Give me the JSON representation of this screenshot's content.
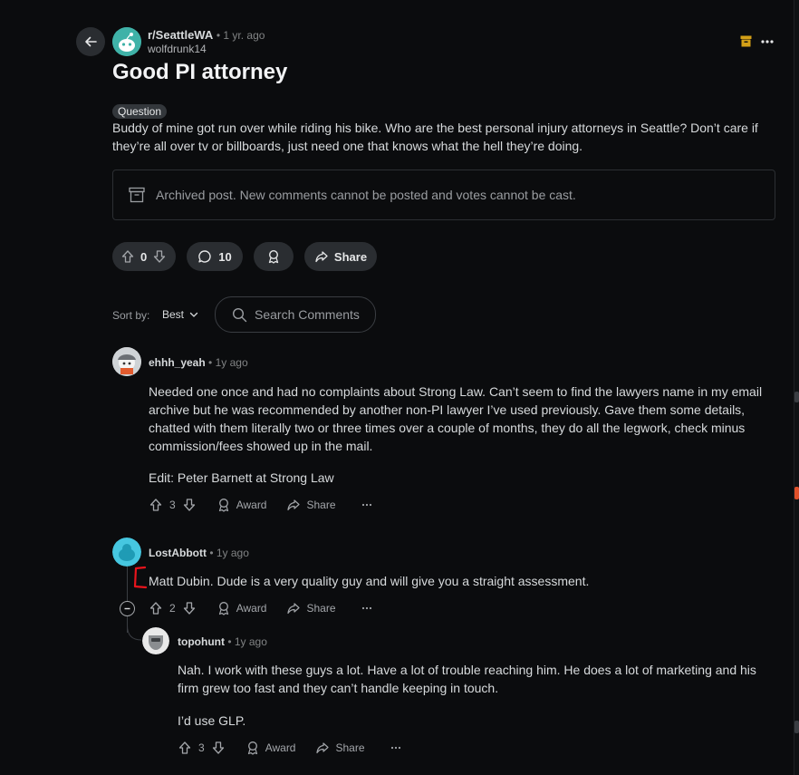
{
  "post": {
    "subreddit": "r/SeattleWA",
    "time": "1 yr. ago",
    "author": "wolfdrunk14",
    "title": "Good PI attorney",
    "flair": "Question",
    "body": "Buddy of mine got run over while riding his bike. Who are the best personal injury attorneys in Seattle? Don’t care if they’re all over tv or billboards, just need one that knows what the hell they’re doing.",
    "archived_notice": "Archived post. New comments cannot be posted and votes cannot be cast.",
    "score": "0",
    "comment_count": "10",
    "share_label": "Share"
  },
  "sort": {
    "label": "Sort by:",
    "value": "Best"
  },
  "search": {
    "placeholder": "Search Comments"
  },
  "comments": [
    {
      "author": "ehhh_yeah",
      "time": "1y ago",
      "text": "Needed one once and had no complaints about Strong Law. Can’t seem to find the lawyers name in my email archive but he was recommended by another non-PI lawyer I’ve used previously. Gave them some details, chatted with them literally two or three times over a couple of months, they do all the legwork, check minus commission/fees showed up in the mail.",
      "edit": "Edit: Peter Barnett at Strong Law",
      "score": "3",
      "award": "Award",
      "share": "Share"
    },
    {
      "author": "LostAbbott",
      "time": "1y ago",
      "text": "Matt Dubin. Dude is a very quality guy and will give you a straight assessment.",
      "score": "2",
      "award": "Award",
      "share": "Share"
    },
    {
      "author": "topohunt",
      "time": "1y ago",
      "text": "Nah. I work with these guys a lot. Have a lot of trouble reaching him. He does a lot of marketing and his firm grew too fast and they can’t handle keeping in touch.",
      "text2": "I’d use GLP.",
      "score": "3",
      "award": "Award",
      "share": "Share"
    }
  ],
  "colors": {
    "background": "#0b0c0e",
    "pill": "#2a2d31",
    "accent_orange": "#d4a017",
    "annotation_red": "#e8141c",
    "avatar_teal": "#3fb2a8",
    "avatar_cyan": "#46c7e0"
  }
}
